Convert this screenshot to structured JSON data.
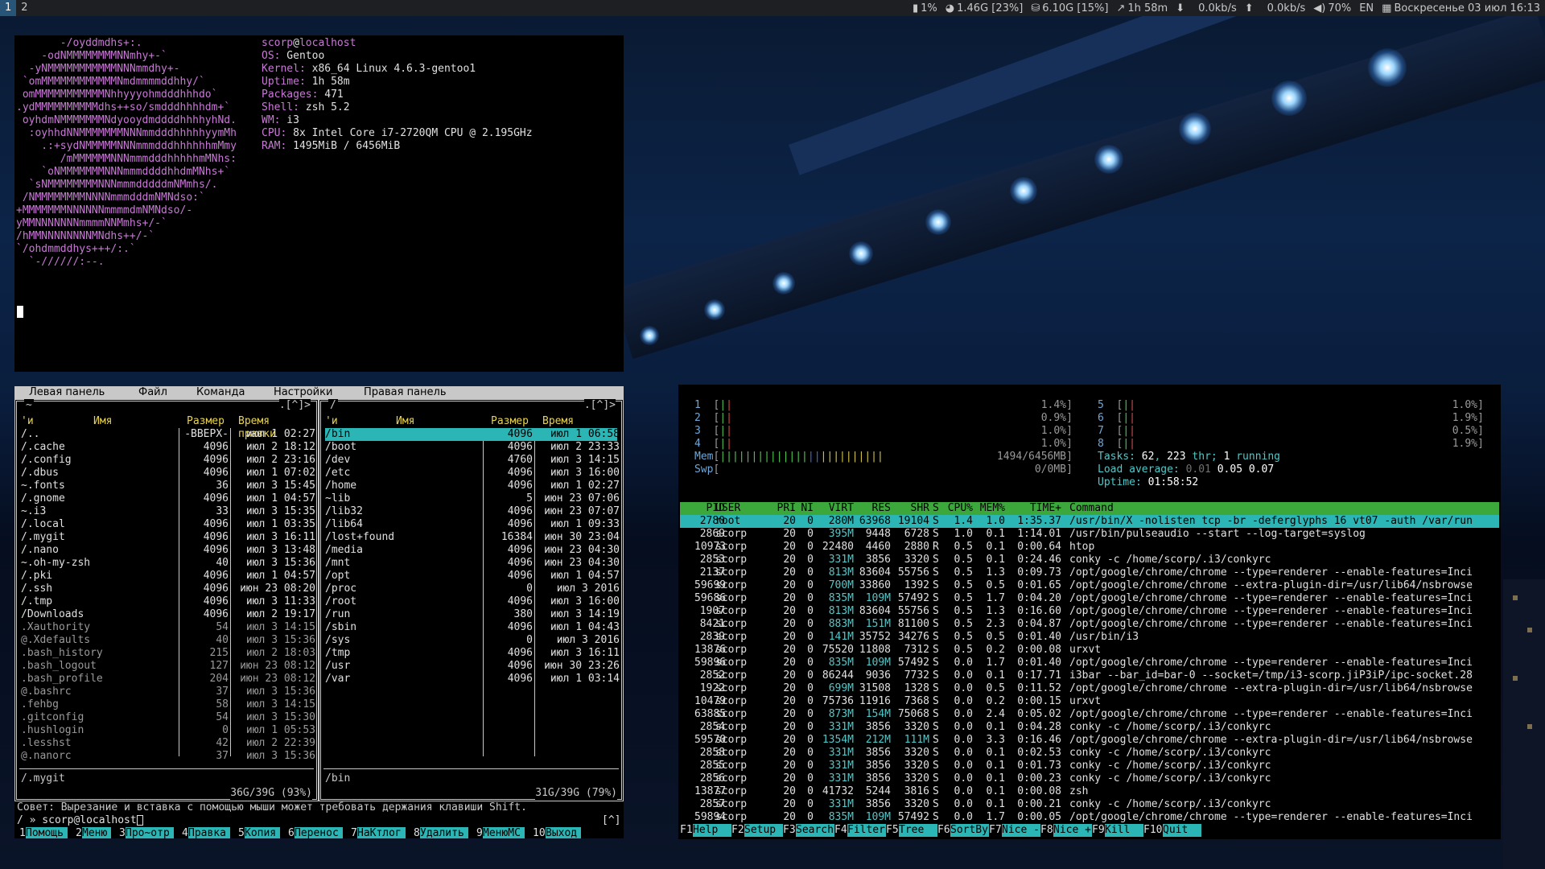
{
  "topbar": {
    "workspaces": [
      "1",
      "2"
    ],
    "cpu": "1%",
    "mem": "1.46G [23%]",
    "disk": "6.10G [15%]",
    "uptime": "1h 58m",
    "net_down": "0.0kb/s",
    "net_up": "0.0kb/s",
    "volume": "70%",
    "layout": "EN",
    "datetime": "Воскресенье 03 июл 16:13",
    "icons": [
      "cpu-chart-icon",
      "pie-chart-icon",
      "disk-icon",
      "line-chart-icon",
      "arrow-down-icon",
      "arrow-up-icon",
      "speaker-icon",
      "calendar-icon"
    ]
  },
  "neofetch": {
    "art": [
      "       -/oyddmdhs+:.",
      "    -odNMMMMMMMMNNmhy+-`",
      "  -yNMMMMMMMMMMMNNNmmdhy+-",
      " `omMMMMMMMMMMMMNmdmmmmddhhy/`",
      " omMMMMMMMMMMMNhhyyyohmdddhhhdo`",
      ".ydMMMMMMMMMMdhs++so/smdddhhhhdm+`",
      " oyhdmNMMMMMMMNdyooydmddddhhhhyhNd.",
      "  :oyhhdNNMMMMMMMNNNmmdddhhhhhyymMh",
      "    .:+sydNMMMMMNNNmmmdddhhhhhhmMmy",
      "       /mMMMMMMNNNmmmdddhhhhhmMNhs:",
      "    `oNMMMMMMMNNNmmmddddhhdmMNhs+`",
      "  `sNMMMMMMMMNNNmmmdddddmNMmhs/.",
      " /NMMMMMMMMNNNNmmmdddmNMNdso:`",
      "+MMMMMMMNNNNNNmmmmdmNMNdso/-",
      "yMMNNNNNNNmmmmNNMmhs+/-`",
      "/hMMNNNNNNNNMNdhs++/-`",
      "`/ohdmmddhys+++/:.`",
      "  `-//////:--."
    ],
    "user": "scorp",
    "at": "@",
    "host": "localhost",
    "info": [
      {
        "key": "OS:",
        "value": "Gentoo"
      },
      {
        "key": "Kernel:",
        "value": "x86_64 Linux 4.6.3-gentoo1"
      },
      {
        "key": "Uptime:",
        "value": "1h 58m"
      },
      {
        "key": "Packages:",
        "value": "471"
      },
      {
        "key": "Shell:",
        "value": "zsh 5.2"
      },
      {
        "key": "WM:",
        "value": "i3"
      },
      {
        "key": "CPU:",
        "value": "8x Intel Core i7-2720QM CPU @ 2.195GHz"
      },
      {
        "key": "RAM:",
        "value": "1495MiB / 6456MiB"
      }
    ]
  },
  "mc": {
    "menu": [
      "Левая панель",
      "Файл",
      "Команда",
      "Настройки",
      "Правая панель"
    ],
    "left": {
      "path": "~",
      "brackets": ".[^]>",
      "headers": {
        "flag": "'и",
        "name": "Имя",
        "size": "Размер",
        "mtime": "Время правки"
      },
      "rows": [
        {
          "name": "/..",
          "size": "-ВВЕРХ-",
          "mtime": "июл  1 02:27"
        },
        {
          "name": "/.cache",
          "size": "4096",
          "mtime": "июл  2 18:12"
        },
        {
          "name": "/.config",
          "size": "4096",
          "mtime": "июл  2 23:16"
        },
        {
          "name": "/.dbus",
          "size": "4096",
          "mtime": "июл  1 07:02"
        },
        {
          "name": "~.fonts",
          "size": "36",
          "mtime": "июл  3 15:45"
        },
        {
          "name": "/.gnome",
          "size": "4096",
          "mtime": "июл  1 04:57"
        },
        {
          "name": "~.i3",
          "size": "33",
          "mtime": "июл  3 15:35"
        },
        {
          "name": "/.local",
          "size": "4096",
          "mtime": "июл  1 03:35"
        },
        {
          "name": "/.mygit",
          "size": "4096",
          "mtime": "июл  3 16:11"
        },
        {
          "name": "/.nano",
          "size": "4096",
          "mtime": "июл  3 13:48"
        },
        {
          "name": "~.oh-my-zsh",
          "size": "40",
          "mtime": "июл  3 15:36"
        },
        {
          "name": "/.pki",
          "size": "4096",
          "mtime": "июл  1 04:57"
        },
        {
          "name": "/.ssh",
          "size": "4096",
          "mtime": "июн 23 08:20"
        },
        {
          "name": "/.tmp",
          "size": "4096",
          "mtime": "июл  3 11:33"
        },
        {
          "name": "/Downloads",
          "size": "4096",
          "mtime": "июл  2 19:17"
        },
        {
          "name": " .Xauthority",
          "size": "54",
          "mtime": "июл  3 14:15",
          "dim": true
        },
        {
          "name": "@.Xdefaults",
          "size": "40",
          "mtime": "июл  3 15:36",
          "dim": true
        },
        {
          "name": " .bash_history",
          "size": "215",
          "mtime": "июл  2 18:03",
          "dim": true
        },
        {
          "name": " .bash_logout",
          "size": "127",
          "mtime": "июн 23 08:12",
          "dim": true
        },
        {
          "name": " .bash_profile",
          "size": "204",
          "mtime": "июн 23 08:12",
          "dim": true
        },
        {
          "name": "@.bashrc",
          "size": "37",
          "mtime": "июл  3 15:36",
          "dim": true
        },
        {
          "name": " .fehbg",
          "size": "58",
          "mtime": "июл  3 14:15",
          "dim": true
        },
        {
          "name": " .gitconfig",
          "size": "54",
          "mtime": "июл  3 15:30",
          "dim": true
        },
        {
          "name": " .hushlogin",
          "size": "0",
          "mtime": "июл  1 05:53",
          "dim": true
        },
        {
          "name": " .lesshst",
          "size": "42",
          "mtime": "июл  2 22:39",
          "dim": true
        },
        {
          "name": "@.nanorc",
          "size": "37",
          "mtime": "июл  3 15:36",
          "dim": true
        }
      ],
      "footer": "/.mygit",
      "free": "36G/39G (93%)"
    },
    "right": {
      "path": "/",
      "brackets": ".[^]>",
      "headers": {
        "flag": "'и",
        "name": "Имя",
        "size": "Размер",
        "mtime": "Время правки"
      },
      "rows": [
        {
          "name": "/bin",
          "size": "4096",
          "mtime": "июл  1 06:58",
          "sel": true
        },
        {
          "name": "/boot",
          "size": "4096",
          "mtime": "июл  2 23:33"
        },
        {
          "name": "/dev",
          "size": "4760",
          "mtime": "июл  3 14:15"
        },
        {
          "name": "/etc",
          "size": "4096",
          "mtime": "июл  3 16:00"
        },
        {
          "name": "/home",
          "size": "4096",
          "mtime": "июл  1 02:27"
        },
        {
          "name": "~lib",
          "size": "5",
          "mtime": "июн 23 07:06"
        },
        {
          "name": "/lib32",
          "size": "4096",
          "mtime": "июн 23 07:07"
        },
        {
          "name": "/lib64",
          "size": "4096",
          "mtime": "июл  1 09:33"
        },
        {
          "name": "/lost+found",
          "size": "16384",
          "mtime": "июн 30 23:04"
        },
        {
          "name": "/media",
          "size": "4096",
          "mtime": "июн 23 04:30"
        },
        {
          "name": "/mnt",
          "size": "4096",
          "mtime": "июн 23 04:30"
        },
        {
          "name": "/opt",
          "size": "4096",
          "mtime": "июл  1 04:57"
        },
        {
          "name": "/proc",
          "size": "0",
          "mtime": "июл  3  2016"
        },
        {
          "name": "/root",
          "size": "4096",
          "mtime": "июл  3 16:00"
        },
        {
          "name": "/run",
          "size": "380",
          "mtime": "июл  3 14:19"
        },
        {
          "name": "/sbin",
          "size": "4096",
          "mtime": "июл  1 04:43"
        },
        {
          "name": "/sys",
          "size": "0",
          "mtime": "июл  3  2016"
        },
        {
          "name": "/tmp",
          "size": "4096",
          "mtime": "июл  3 16:11"
        },
        {
          "name": "/usr",
          "size": "4096",
          "mtime": "июн 30 23:26"
        },
        {
          "name": "/var",
          "size": "4096",
          "mtime": "июл  1 03:14"
        }
      ],
      "footer": "/bin",
      "free": "31G/39G (79%)"
    },
    "hint": "Совет: Вырезание и вставка с помощью мыши может требовать держания клавиши Shift.",
    "prompt": "/ » scorp@localhost",
    "prompt_right": "[^]",
    "keys": [
      {
        "k": "1",
        "l": "Помощь"
      },
      {
        "k": "2",
        "l": "Меню"
      },
      {
        "k": "3",
        "l": "Про~отр"
      },
      {
        "k": "4",
        "l": "Правка"
      },
      {
        "k": "5",
        "l": "Копия"
      },
      {
        "k": "6",
        "l": "Перенос"
      },
      {
        "k": "7",
        "l": "НаКтлог"
      },
      {
        "k": "8",
        "l": "Удалить"
      },
      {
        "k": "9",
        "l": "МенюMC"
      },
      {
        "k": "10",
        "l": "Выход"
      }
    ]
  },
  "htop": {
    "cpus": [
      {
        "n": "1",
        "pct": "1.4%"
      },
      {
        "n": "2",
        "pct": "0.9%"
      },
      {
        "n": "3",
        "pct": "1.0%"
      },
      {
        "n": "4",
        "pct": "1.0%"
      },
      {
        "n": "5",
        "pct": "1.0%"
      },
      {
        "n": "6",
        "pct": "1.9%"
      },
      {
        "n": "7",
        "pct": "0.5%"
      },
      {
        "n": "8",
        "pct": "1.9%"
      }
    ],
    "mem_label": "Mem",
    "mem_value": "1494/6456MB",
    "swp_label": "Swp",
    "swp_value": "0/0MB",
    "tasks_label": "Tasks:",
    "tasks": "62",
    "thr": "223",
    "thr_label": "thr;",
    "running": "1",
    "running_label": "running",
    "load_label": "Load average:",
    "load1": "0.01",
    "load5": "0.05",
    "load15": "0.07",
    "uptime_label": "Uptime:",
    "uptime": "01:58:52",
    "headers": [
      "PID",
      "USER",
      "PRI",
      "NI",
      "VIRT",
      "RES",
      "SHR",
      "S",
      "CPU%",
      "MEM%",
      "TIME+",
      "Command"
    ],
    "rows": [
      [
        "2780",
        "root",
        "20",
        "0",
        "280M",
        "63968",
        "19104",
        "S",
        "1.4",
        "1.0",
        "1:35.37",
        "/usr/bin/X -nolisten tcp -br -deferglyphs 16 vt07 -auth /var/run"
      ],
      [
        "2869",
        "scorp",
        "20",
        "0",
        "395M",
        "9448",
        "6728",
        "S",
        "1.0",
        "0.1",
        "1:14.01",
        "/usr/bin/pulseaudio --start --log-target=syslog"
      ],
      [
        "10973",
        "scorp",
        "20",
        "0",
        "22480",
        "4460",
        "2880",
        "R",
        "0.5",
        "0.1",
        "0:00.64",
        "htop"
      ],
      [
        "2853",
        "scorp",
        "20",
        "0",
        "331M",
        "3856",
        "3320",
        "S",
        "0.5",
        "0.1",
        "0:24.46",
        "conky -c /home/scorp/.i3/conkyrc"
      ],
      [
        "2137",
        "scorp",
        "20",
        "0",
        "813M",
        "83604",
        "55756",
        "S",
        "0.5",
        "1.3",
        "0:09.73",
        "/opt/google/chrome/chrome --type=renderer --enable-features=Inci"
      ],
      [
        "59699",
        "scorp",
        "20",
        "0",
        "700M",
        "33860",
        "1392",
        "S",
        "0.5",
        "0.5",
        "0:01.65",
        "/opt/google/chrome/chrome --extra-plugin-dir=/usr/lib64/nsbrowse"
      ],
      [
        "59686",
        "scorp",
        "20",
        "0",
        "835M",
        "109M",
        "57492",
        "S",
        "0.5",
        "1.7",
        "0:04.20",
        "/opt/google/chrome/chrome --type=renderer --enable-features=Inci"
      ],
      [
        "1907",
        "scorp",
        "20",
        "0",
        "813M",
        "83604",
        "55756",
        "S",
        "0.5",
        "1.3",
        "0:16.60",
        "/opt/google/chrome/chrome --type=renderer --enable-features=Inci"
      ],
      [
        "8421",
        "scorp",
        "20",
        "0",
        "883M",
        "151M",
        "81100",
        "S",
        "0.5",
        "2.3",
        "0:04.87",
        "/opt/google/chrome/chrome --type=renderer --enable-features=Inci"
      ],
      [
        "2839",
        "scorp",
        "20",
        "0",
        "141M",
        "35752",
        "34276",
        "S",
        "0.5",
        "0.5",
        "0:01.40",
        "/usr/bin/i3"
      ],
      [
        "13876",
        "scorp",
        "20",
        "0",
        "75520",
        "11808",
        "7312",
        "S",
        "0.5",
        "0.2",
        "0:00.08",
        "urxvt"
      ],
      [
        "59896",
        "scorp",
        "20",
        "0",
        "835M",
        "109M",
        "57492",
        "S",
        "0.0",
        "1.7",
        "0:01.40",
        "/opt/google/chrome/chrome --type=renderer --enable-features=Inci"
      ],
      [
        "2852",
        "scorp",
        "20",
        "0",
        "86244",
        "9036",
        "7732",
        "S",
        "0.0",
        "0.1",
        "0:17.71",
        "i3bar --bar_id=bar-0 --socket=/tmp/i3-scorp.jiP3iP/ipc-socket.28"
      ],
      [
        "1922",
        "scorp",
        "20",
        "0",
        "699M",
        "31508",
        "1328",
        "S",
        "0.0",
        "0.5",
        "0:11.52",
        "/opt/google/chrome/chrome --extra-plugin-dir=/usr/lib64/nsbrowse"
      ],
      [
        "10479",
        "scorp",
        "20",
        "0",
        "75736",
        "11916",
        "7368",
        "S",
        "0.0",
        "0.2",
        "0:00.15",
        "urxvt"
      ],
      [
        "63885",
        "scorp",
        "20",
        "0",
        "873M",
        "154M",
        "75068",
        "S",
        "0.0",
        "2.4",
        "0:05.02",
        "/opt/google/chrome/chrome --type=renderer --enable-features=Inci"
      ],
      [
        "2854",
        "scorp",
        "20",
        "0",
        "331M",
        "3856",
        "3320",
        "S",
        "0.0",
        "0.1",
        "0:04.28",
        "conky -c /home/scorp/.i3/conkyrc"
      ],
      [
        "59570",
        "scorp",
        "20",
        "0",
        "1354M",
        "212M",
        "111M",
        "S",
        "0.0",
        "3.3",
        "0:16.46",
        "/opt/google/chrome/chrome --extra-plugin-dir=/usr/lib64/nsbrowse"
      ],
      [
        "2858",
        "scorp",
        "20",
        "0",
        "331M",
        "3856",
        "3320",
        "S",
        "0.0",
        "0.1",
        "0:02.53",
        "conky -c /home/scorp/.i3/conkyrc"
      ],
      [
        "2855",
        "scorp",
        "20",
        "0",
        "331M",
        "3856",
        "3320",
        "S",
        "0.0",
        "0.1",
        "0:01.73",
        "conky -c /home/scorp/.i3/conkyrc"
      ],
      [
        "2856",
        "scorp",
        "20",
        "0",
        "331M",
        "3856",
        "3320",
        "S",
        "0.0",
        "0.1",
        "0:00.23",
        "conky -c /home/scorp/.i3/conkyrc"
      ],
      [
        "13877",
        "scorp",
        "20",
        "0",
        "41732",
        "5244",
        "3816",
        "S",
        "0.0",
        "0.1",
        "0:00.08",
        "zsh"
      ],
      [
        "2857",
        "scorp",
        "20",
        "0",
        "331M",
        "3856",
        "3320",
        "S",
        "0.0",
        "0.1",
        "0:00.21",
        "conky -c /home/scorp/.i3/conkyrc"
      ],
      [
        "59894",
        "scorp",
        "20",
        "0",
        "835M",
        "109M",
        "57492",
        "S",
        "0.0",
        "1.7",
        "0:00.05",
        "/opt/google/chrome/chrome --type=renderer --enable-features=Inci"
      ]
    ],
    "keys": [
      {
        "k": "F1",
        "l": "Help"
      },
      {
        "k": "F2",
        "l": "Setup"
      },
      {
        "k": "F3",
        "l": "Search"
      },
      {
        "k": "F4",
        "l": "Filter"
      },
      {
        "k": "F5",
        "l": "Tree"
      },
      {
        "k": "F6",
        "l": "SortBy"
      },
      {
        "k": "F7",
        "l": "Nice -"
      },
      {
        "k": "F8",
        "l": "Nice +"
      },
      {
        "k": "F9",
        "l": "Kill"
      },
      {
        "k": "F10",
        "l": "Quit"
      }
    ]
  }
}
